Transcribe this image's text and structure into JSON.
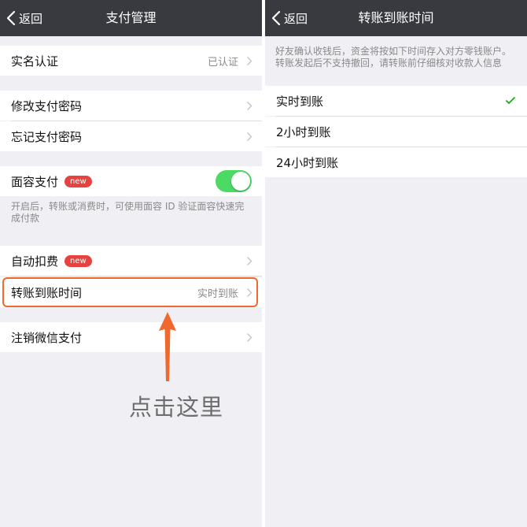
{
  "colors": {
    "navbar": "#393a3f",
    "page_background": "#efeff4",
    "badge": "#e64340",
    "toggle_on": "#4cd964",
    "check": "#1aad19",
    "annotation_accent": "#f0682e"
  },
  "left": {
    "nav": {
      "back_label": "返回",
      "title": "支付管理"
    },
    "real_name": {
      "label": "实名认证",
      "value": "已认证"
    },
    "change_password": {
      "label": "修改支付密码"
    },
    "forgot_password": {
      "label": "忘记支付密码"
    },
    "face_pay": {
      "label": "面容支付",
      "badge": "new",
      "toggle_on": true,
      "hint": "开启后，转账或消费时，可使用面容 ID 验证面容快速完成付款"
    },
    "auto_deduct": {
      "label": "自动扣费",
      "badge": "new"
    },
    "transfer_time": {
      "label": "转账到账时间",
      "value": "实时到账"
    },
    "close_wechat_pay": {
      "label": "注销微信支付"
    },
    "annotation": {
      "text": "点击这里"
    }
  },
  "right": {
    "nav": {
      "back_label": "返回",
      "title": "转账到账时间"
    },
    "notice": "好友确认收钱后，资金将按如下时间存入对方零钱账户。转账发起后不支持撤回，请转账前仔细核对收款人信息",
    "options": [
      {
        "label": "实时到账",
        "selected": true
      },
      {
        "label": "2小时到账",
        "selected": false
      },
      {
        "label": "24小时到账",
        "selected": false
      }
    ]
  }
}
